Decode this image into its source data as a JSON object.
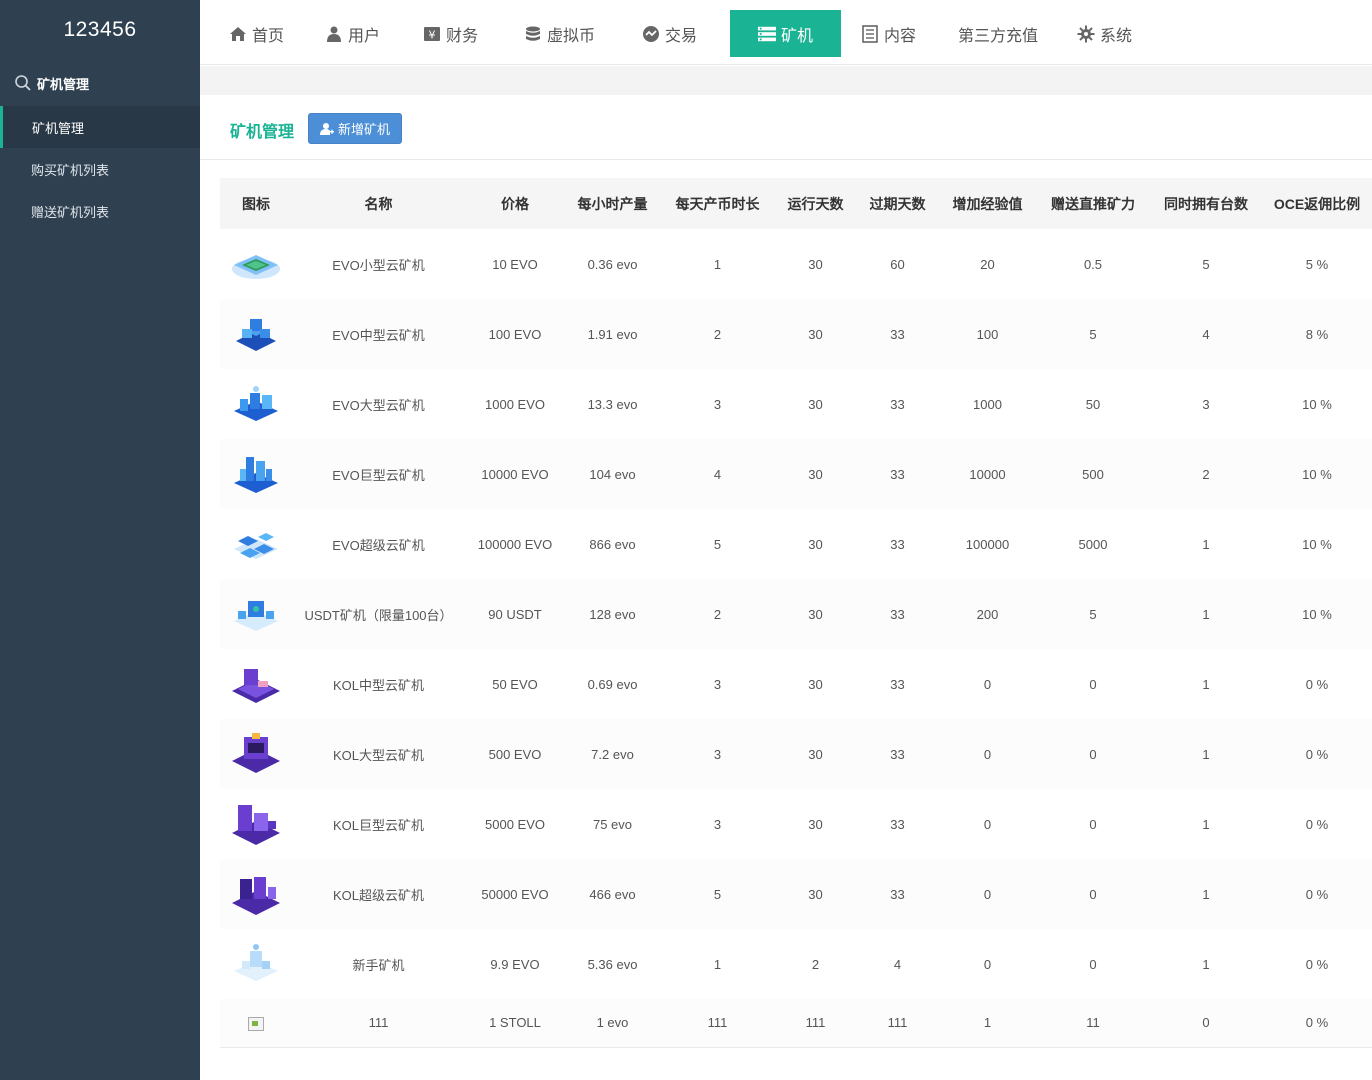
{
  "app": {
    "brand": "123456"
  },
  "sidebar": {
    "section": "矿机管理",
    "items": [
      {
        "label": "矿机管理",
        "active": true
      },
      {
        "label": "购买矿机列表",
        "active": false
      },
      {
        "label": "赠送矿机列表",
        "active": false
      }
    ]
  },
  "nav": {
    "items": [
      {
        "label": "首页",
        "icon": "home-icon"
      },
      {
        "label": "用户",
        "icon": "user-icon"
      },
      {
        "label": "财务",
        "icon": "yen-icon"
      },
      {
        "label": "虚拟币",
        "icon": "database-icon"
      },
      {
        "label": "交易",
        "icon": "exchange-icon"
      },
      {
        "label": "矿机",
        "icon": "server-icon",
        "active": true
      },
      {
        "label": "内容",
        "icon": "document-icon"
      },
      {
        "label": "第三方充值",
        "icon": ""
      },
      {
        "label": "系统",
        "icon": "gear-icon"
      }
    ]
  },
  "content": {
    "title": "矿机管理",
    "add_button": "新增矿机"
  },
  "table": {
    "headers": [
      "图标",
      "名称",
      "价格",
      "每小时产量",
      "每天产币时长",
      "运行天数",
      "过期天数",
      "增加经验值",
      "赠送直推矿力",
      "同时拥有台数",
      "OCE返佣比例"
    ],
    "rows": [
      {
        "icon": "blue-small",
        "name": "EVO小型云矿机",
        "price": "10 EVO",
        "hourly": "0.36 evo",
        "daily_hours": "1",
        "run_days": "30",
        "expire_days": "60",
        "exp": "20",
        "bonus": "0.5",
        "max_own": "5",
        "rebate": "5 %"
      },
      {
        "icon": "blue-medium",
        "name": "EVO中型云矿机",
        "price": "100 EVO",
        "hourly": "1.91 evo",
        "daily_hours": "2",
        "run_days": "30",
        "expire_days": "33",
        "exp": "100",
        "bonus": "5",
        "max_own": "4",
        "rebate": "8 %"
      },
      {
        "icon": "blue-large",
        "name": "EVO大型云矿机",
        "price": "1000 EVO",
        "hourly": "13.3 evo",
        "daily_hours": "3",
        "run_days": "30",
        "expire_days": "33",
        "exp": "1000",
        "bonus": "50",
        "max_own": "3",
        "rebate": "10 %"
      },
      {
        "icon": "blue-huge",
        "name": "EVO巨型云矿机",
        "price": "10000 EVO",
        "hourly": "104 evo",
        "daily_hours": "4",
        "run_days": "30",
        "expire_days": "33",
        "exp": "10000",
        "bonus": "500",
        "max_own": "2",
        "rebate": "10 %"
      },
      {
        "icon": "blue-super",
        "name": "EVO超级云矿机",
        "price": "100000 EVO",
        "hourly": "866 evo",
        "daily_hours": "5",
        "run_days": "30",
        "expire_days": "33",
        "exp": "100000",
        "bonus": "5000",
        "max_own": "1",
        "rebate": "10 %"
      },
      {
        "icon": "blue-usdt",
        "name": "USDT矿机（限量100台）",
        "price": "90 USDT",
        "hourly": "128 evo",
        "daily_hours": "2",
        "run_days": "30",
        "expire_days": "33",
        "exp": "200",
        "bonus": "5",
        "max_own": "1",
        "rebate": "10 %"
      },
      {
        "icon": "purple-medium",
        "name": "KOL中型云矿机",
        "price": "50 EVO",
        "hourly": "0.69 evo",
        "daily_hours": "3",
        "run_days": "30",
        "expire_days": "33",
        "exp": "0",
        "bonus": "0",
        "max_own": "1",
        "rebate": "0 %"
      },
      {
        "icon": "purple-large",
        "name": "KOL大型云矿机",
        "price": "500 EVO",
        "hourly": "7.2 evo",
        "daily_hours": "3",
        "run_days": "30",
        "expire_days": "33",
        "exp": "0",
        "bonus": "0",
        "max_own": "1",
        "rebate": "0 %"
      },
      {
        "icon": "purple-huge",
        "name": "KOL巨型云矿机",
        "price": "5000 EVO",
        "hourly": "75 evo",
        "daily_hours": "3",
        "run_days": "30",
        "expire_days": "33",
        "exp": "0",
        "bonus": "0",
        "max_own": "1",
        "rebate": "0 %"
      },
      {
        "icon": "purple-super",
        "name": "KOL超级云矿机",
        "price": "50000 EVO",
        "hourly": "466 evo",
        "daily_hours": "5",
        "run_days": "30",
        "expire_days": "33",
        "exp": "0",
        "bonus": "0",
        "max_own": "1",
        "rebate": "0 %"
      },
      {
        "icon": "light-newbie",
        "name": "新手矿机",
        "price": "9.9 EVO",
        "hourly": "5.36 evo",
        "daily_hours": "1",
        "run_days": "2",
        "expire_days": "4",
        "exp": "0",
        "bonus": "0",
        "max_own": "1",
        "rebate": "0 %"
      },
      {
        "icon": "broken-image",
        "name": "111",
        "price": "1 STOLL",
        "hourly": "1 evo",
        "daily_hours": "111",
        "run_days": "111",
        "expire_days": "111",
        "exp": "1",
        "bonus": "11",
        "max_own": "0",
        "rebate": "0 %"
      }
    ]
  },
  "colors": {
    "sidebar_bg": "#2f4050",
    "accent": "#1ab394",
    "button_blue": "#4d8fd6",
    "blue_icon": "#2f7de1",
    "purple_icon": "#6a3fd0"
  }
}
